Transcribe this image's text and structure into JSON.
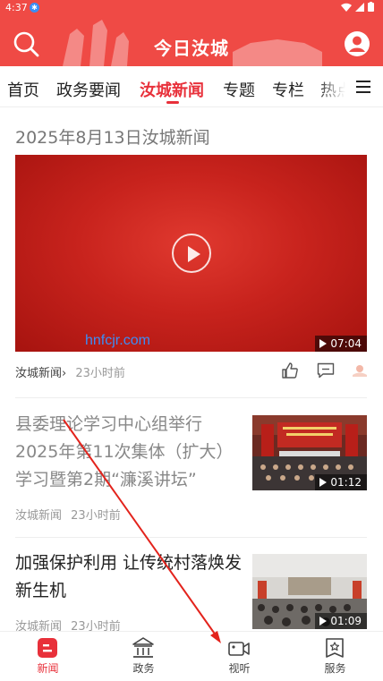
{
  "status_bar": {
    "time": "4:37"
  },
  "header": {
    "title": "今日汝城"
  },
  "tabs": [
    {
      "label": "首页"
    },
    {
      "label": "政务要闻"
    },
    {
      "label": "汝城新闻"
    },
    {
      "label": "专题"
    },
    {
      "label": "专栏"
    },
    {
      "label": "热点"
    }
  ],
  "active_tab": "汝城新闻",
  "video_card": {
    "title": "2025年8月13日汝城新闻",
    "watermark": "hnfcjr.com",
    "duration": "07:04",
    "source": "汝城新闻",
    "source_arrow": "›",
    "time": "23小时前"
  },
  "news": [
    {
      "title": "县委理论学习中心组举行2025年第11次集体（扩大）学习暨第2期“濂溪讲坛”",
      "source": "汝城新闻",
      "time": "23小时前",
      "duration": "01:12"
    },
    {
      "title": "加强保护利用 让传统村落焕发新生机",
      "source": "汝城新闻",
      "time": "23小时前",
      "duration": "01:09"
    }
  ],
  "bottom_nav": [
    {
      "label": "新闻",
      "icon": "news-icon"
    },
    {
      "label": "政务",
      "icon": "government-icon"
    },
    {
      "label": "视听",
      "icon": "video-camera-icon"
    },
    {
      "label": "服务",
      "icon": "service-icon"
    }
  ],
  "colors": {
    "brand_red": "#ef4a45",
    "active_red": "#e8303a",
    "watermark_blue": "#3c8df5"
  }
}
